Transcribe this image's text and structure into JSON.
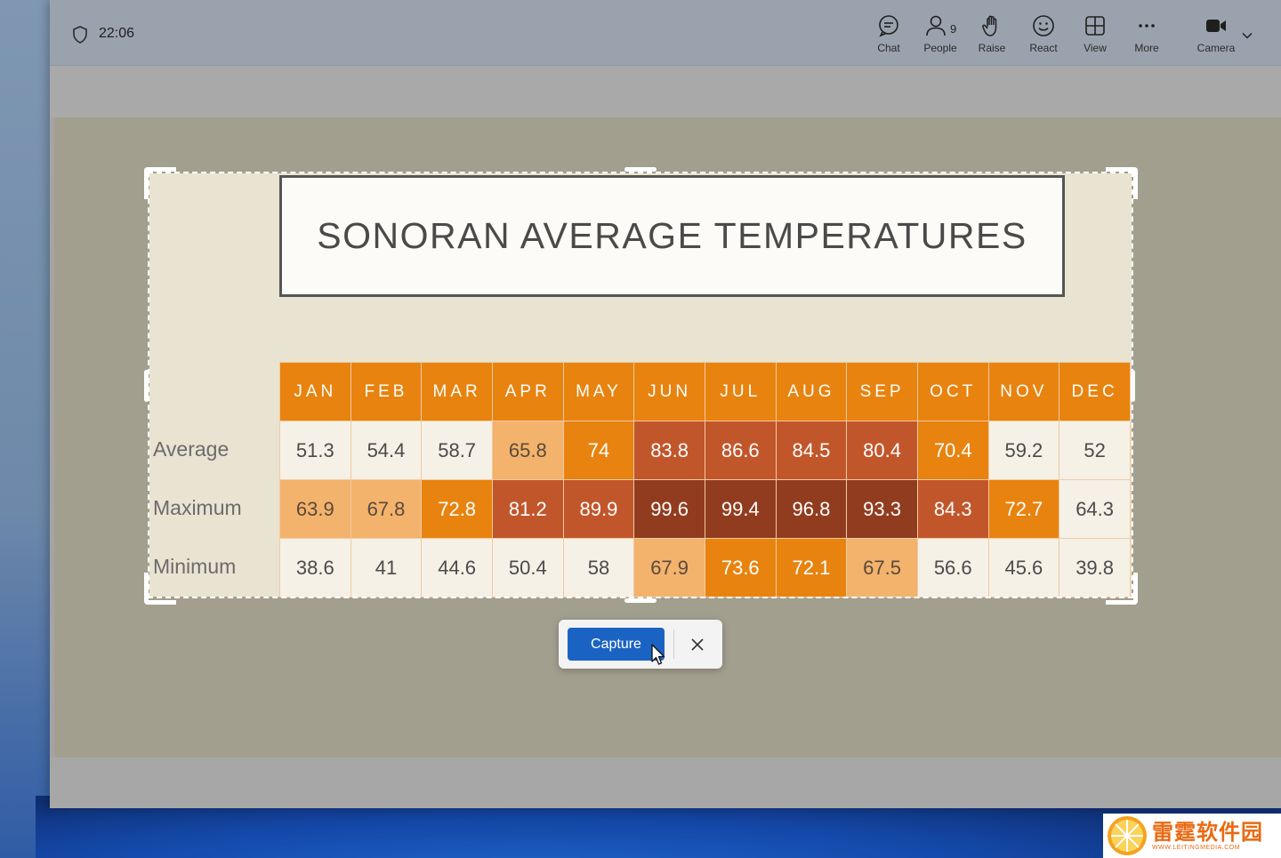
{
  "topbar": {
    "time": "22:06",
    "buttons": [
      {
        "label": "Chat",
        "icon": "chat-icon"
      },
      {
        "label": "People",
        "icon": "people-icon",
        "count": "9"
      },
      {
        "label": "Raise",
        "icon": "raise-hand-icon"
      },
      {
        "label": "React",
        "icon": "smiley-icon"
      },
      {
        "label": "View",
        "icon": "grid-view-icon"
      },
      {
        "label": "More",
        "icon": "more-dots-icon"
      },
      {
        "label": "Camera",
        "icon": "camera-icon"
      }
    ]
  },
  "slide": {
    "title": "SONORAN AVERAGE TEMPERATURES",
    "months": [
      "JAN",
      "FEB",
      "MAR",
      "APR",
      "MAY",
      "JUN",
      "JUL",
      "AUG",
      "SEP",
      "OCT",
      "NOV",
      "DEC"
    ],
    "rows": [
      {
        "label": "Average",
        "values": [
          "51.3",
          "54.4",
          "58.7",
          "65.8",
          "74",
          "83.8",
          "86.6",
          "84.5",
          "80.4",
          "70.4",
          "59.2",
          "52"
        ]
      },
      {
        "label": "Maximum",
        "values": [
          "63.9",
          "67.8",
          "72.8",
          "81.2",
          "89.9",
          "99.6",
          "99.4",
          "96.8",
          "93.3",
          "84.3",
          "72.7",
          "64.3"
        ]
      },
      {
        "label": "Minimum",
        "values": [
          "38.6",
          "41",
          "44.6",
          "50.4",
          "58",
          "67.9",
          "73.6",
          "72.1",
          "67.5",
          "56.6",
          "45.6",
          "39.8"
        ]
      }
    ],
    "colors": {
      "header": "#e8830f",
      "cream": "#f5f1e6",
      "light_orange": "#f3b36c",
      "orange": "#e8830f",
      "red_orange": "#c2562b",
      "dark": "#923c1f"
    }
  },
  "capture": {
    "capture_label": "Capture"
  },
  "watermark": {
    "title": "雷霆软件园",
    "url": "WWW.LEITINGMEDIA.COM"
  }
}
